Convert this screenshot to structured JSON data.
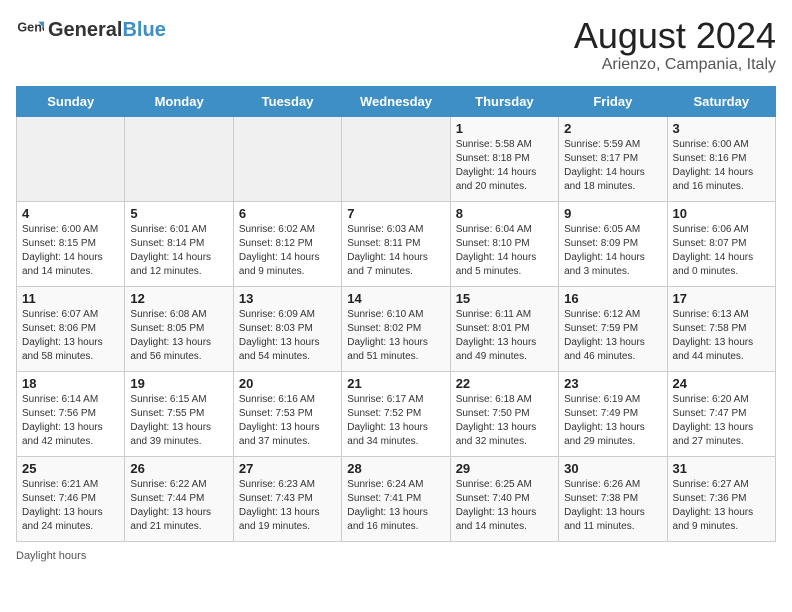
{
  "header": {
    "logo_general": "General",
    "logo_blue": "Blue",
    "month_title": "August 2024",
    "location": "Arienzo, Campania, Italy"
  },
  "weekdays": [
    "Sunday",
    "Monday",
    "Tuesday",
    "Wednesday",
    "Thursday",
    "Friday",
    "Saturday"
  ],
  "footer": {
    "daylight_label": "Daylight hours"
  },
  "weeks": [
    [
      {
        "day": "",
        "info": ""
      },
      {
        "day": "",
        "info": ""
      },
      {
        "day": "",
        "info": ""
      },
      {
        "day": "",
        "info": ""
      },
      {
        "day": "1",
        "info": "Sunrise: 5:58 AM\nSunset: 8:18 PM\nDaylight: 14 hours and 20 minutes."
      },
      {
        "day": "2",
        "info": "Sunrise: 5:59 AM\nSunset: 8:17 PM\nDaylight: 14 hours and 18 minutes."
      },
      {
        "day": "3",
        "info": "Sunrise: 6:00 AM\nSunset: 8:16 PM\nDaylight: 14 hours and 16 minutes."
      }
    ],
    [
      {
        "day": "4",
        "info": "Sunrise: 6:00 AM\nSunset: 8:15 PM\nDaylight: 14 hours and 14 minutes."
      },
      {
        "day": "5",
        "info": "Sunrise: 6:01 AM\nSunset: 8:14 PM\nDaylight: 14 hours and 12 minutes."
      },
      {
        "day": "6",
        "info": "Sunrise: 6:02 AM\nSunset: 8:12 PM\nDaylight: 14 hours and 9 minutes."
      },
      {
        "day": "7",
        "info": "Sunrise: 6:03 AM\nSunset: 8:11 PM\nDaylight: 14 hours and 7 minutes."
      },
      {
        "day": "8",
        "info": "Sunrise: 6:04 AM\nSunset: 8:10 PM\nDaylight: 14 hours and 5 minutes."
      },
      {
        "day": "9",
        "info": "Sunrise: 6:05 AM\nSunset: 8:09 PM\nDaylight: 14 hours and 3 minutes."
      },
      {
        "day": "10",
        "info": "Sunrise: 6:06 AM\nSunset: 8:07 PM\nDaylight: 14 hours and 0 minutes."
      }
    ],
    [
      {
        "day": "11",
        "info": "Sunrise: 6:07 AM\nSunset: 8:06 PM\nDaylight: 13 hours and 58 minutes."
      },
      {
        "day": "12",
        "info": "Sunrise: 6:08 AM\nSunset: 8:05 PM\nDaylight: 13 hours and 56 minutes."
      },
      {
        "day": "13",
        "info": "Sunrise: 6:09 AM\nSunset: 8:03 PM\nDaylight: 13 hours and 54 minutes."
      },
      {
        "day": "14",
        "info": "Sunrise: 6:10 AM\nSunset: 8:02 PM\nDaylight: 13 hours and 51 minutes."
      },
      {
        "day": "15",
        "info": "Sunrise: 6:11 AM\nSunset: 8:01 PM\nDaylight: 13 hours and 49 minutes."
      },
      {
        "day": "16",
        "info": "Sunrise: 6:12 AM\nSunset: 7:59 PM\nDaylight: 13 hours and 46 minutes."
      },
      {
        "day": "17",
        "info": "Sunrise: 6:13 AM\nSunset: 7:58 PM\nDaylight: 13 hours and 44 minutes."
      }
    ],
    [
      {
        "day": "18",
        "info": "Sunrise: 6:14 AM\nSunset: 7:56 PM\nDaylight: 13 hours and 42 minutes."
      },
      {
        "day": "19",
        "info": "Sunrise: 6:15 AM\nSunset: 7:55 PM\nDaylight: 13 hours and 39 minutes."
      },
      {
        "day": "20",
        "info": "Sunrise: 6:16 AM\nSunset: 7:53 PM\nDaylight: 13 hours and 37 minutes."
      },
      {
        "day": "21",
        "info": "Sunrise: 6:17 AM\nSunset: 7:52 PM\nDaylight: 13 hours and 34 minutes."
      },
      {
        "day": "22",
        "info": "Sunrise: 6:18 AM\nSunset: 7:50 PM\nDaylight: 13 hours and 32 minutes."
      },
      {
        "day": "23",
        "info": "Sunrise: 6:19 AM\nSunset: 7:49 PM\nDaylight: 13 hours and 29 minutes."
      },
      {
        "day": "24",
        "info": "Sunrise: 6:20 AM\nSunset: 7:47 PM\nDaylight: 13 hours and 27 minutes."
      }
    ],
    [
      {
        "day": "25",
        "info": "Sunrise: 6:21 AM\nSunset: 7:46 PM\nDaylight: 13 hours and 24 minutes."
      },
      {
        "day": "26",
        "info": "Sunrise: 6:22 AM\nSunset: 7:44 PM\nDaylight: 13 hours and 21 minutes."
      },
      {
        "day": "27",
        "info": "Sunrise: 6:23 AM\nSunset: 7:43 PM\nDaylight: 13 hours and 19 minutes."
      },
      {
        "day": "28",
        "info": "Sunrise: 6:24 AM\nSunset: 7:41 PM\nDaylight: 13 hours and 16 minutes."
      },
      {
        "day": "29",
        "info": "Sunrise: 6:25 AM\nSunset: 7:40 PM\nDaylight: 13 hours and 14 minutes."
      },
      {
        "day": "30",
        "info": "Sunrise: 6:26 AM\nSunset: 7:38 PM\nDaylight: 13 hours and 11 minutes."
      },
      {
        "day": "31",
        "info": "Sunrise: 6:27 AM\nSunset: 7:36 PM\nDaylight: 13 hours and 9 minutes."
      }
    ]
  ]
}
